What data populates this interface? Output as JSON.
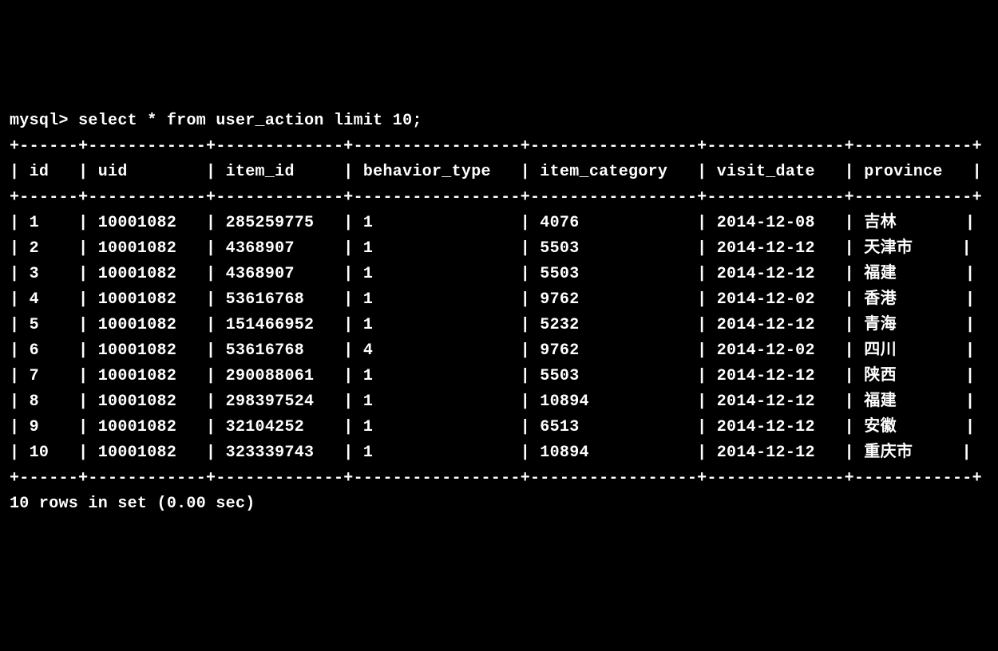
{
  "prompt": "mysql>",
  "query": "select * from user_action limit 10;",
  "columns": [
    "id",
    "uid",
    "item_id",
    "behavior_type",
    "item_category",
    "visit_date",
    "province"
  ],
  "rows": [
    {
      "id": "1",
      "uid": "10001082",
      "item_id": "285259775",
      "behavior_type": "1",
      "item_category": "4076",
      "visit_date": "2014-12-08",
      "province": "吉林"
    },
    {
      "id": "2",
      "uid": "10001082",
      "item_id": "4368907",
      "behavior_type": "1",
      "item_category": "5503",
      "visit_date": "2014-12-12",
      "province": "天津市"
    },
    {
      "id": "3",
      "uid": "10001082",
      "item_id": "4368907",
      "behavior_type": "1",
      "item_category": "5503",
      "visit_date": "2014-12-12",
      "province": "福建"
    },
    {
      "id": "4",
      "uid": "10001082",
      "item_id": "53616768",
      "behavior_type": "1",
      "item_category": "9762",
      "visit_date": "2014-12-02",
      "province": "香港"
    },
    {
      "id": "5",
      "uid": "10001082",
      "item_id": "151466952",
      "behavior_type": "1",
      "item_category": "5232",
      "visit_date": "2014-12-12",
      "province": "青海"
    },
    {
      "id": "6",
      "uid": "10001082",
      "item_id": "53616768",
      "behavior_type": "4",
      "item_category": "9762",
      "visit_date": "2014-12-02",
      "province": "四川"
    },
    {
      "id": "7",
      "uid": "10001082",
      "item_id": "290088061",
      "behavior_type": "1",
      "item_category": "5503",
      "visit_date": "2014-12-12",
      "province": "陕西"
    },
    {
      "id": "8",
      "uid": "10001082",
      "item_id": "298397524",
      "behavior_type": "1",
      "item_category": "10894",
      "visit_date": "2014-12-12",
      "province": "福建"
    },
    {
      "id": "9",
      "uid": "10001082",
      "item_id": "32104252",
      "behavior_type": "1",
      "item_category": "6513",
      "visit_date": "2014-12-12",
      "province": "安徽"
    },
    {
      "id": "10",
      "uid": "10001082",
      "item_id": "323339743",
      "behavior_type": "1",
      "item_category": "10894",
      "visit_date": "2014-12-12",
      "province": "重庆市"
    }
  ],
  "status": "10 rows in set (0.00 sec)",
  "colWidths": {
    "id": 4,
    "uid": 10,
    "item_id": 11,
    "behavior_type": 15,
    "item_category": 15,
    "visit_date": 12,
    "province": 10
  }
}
